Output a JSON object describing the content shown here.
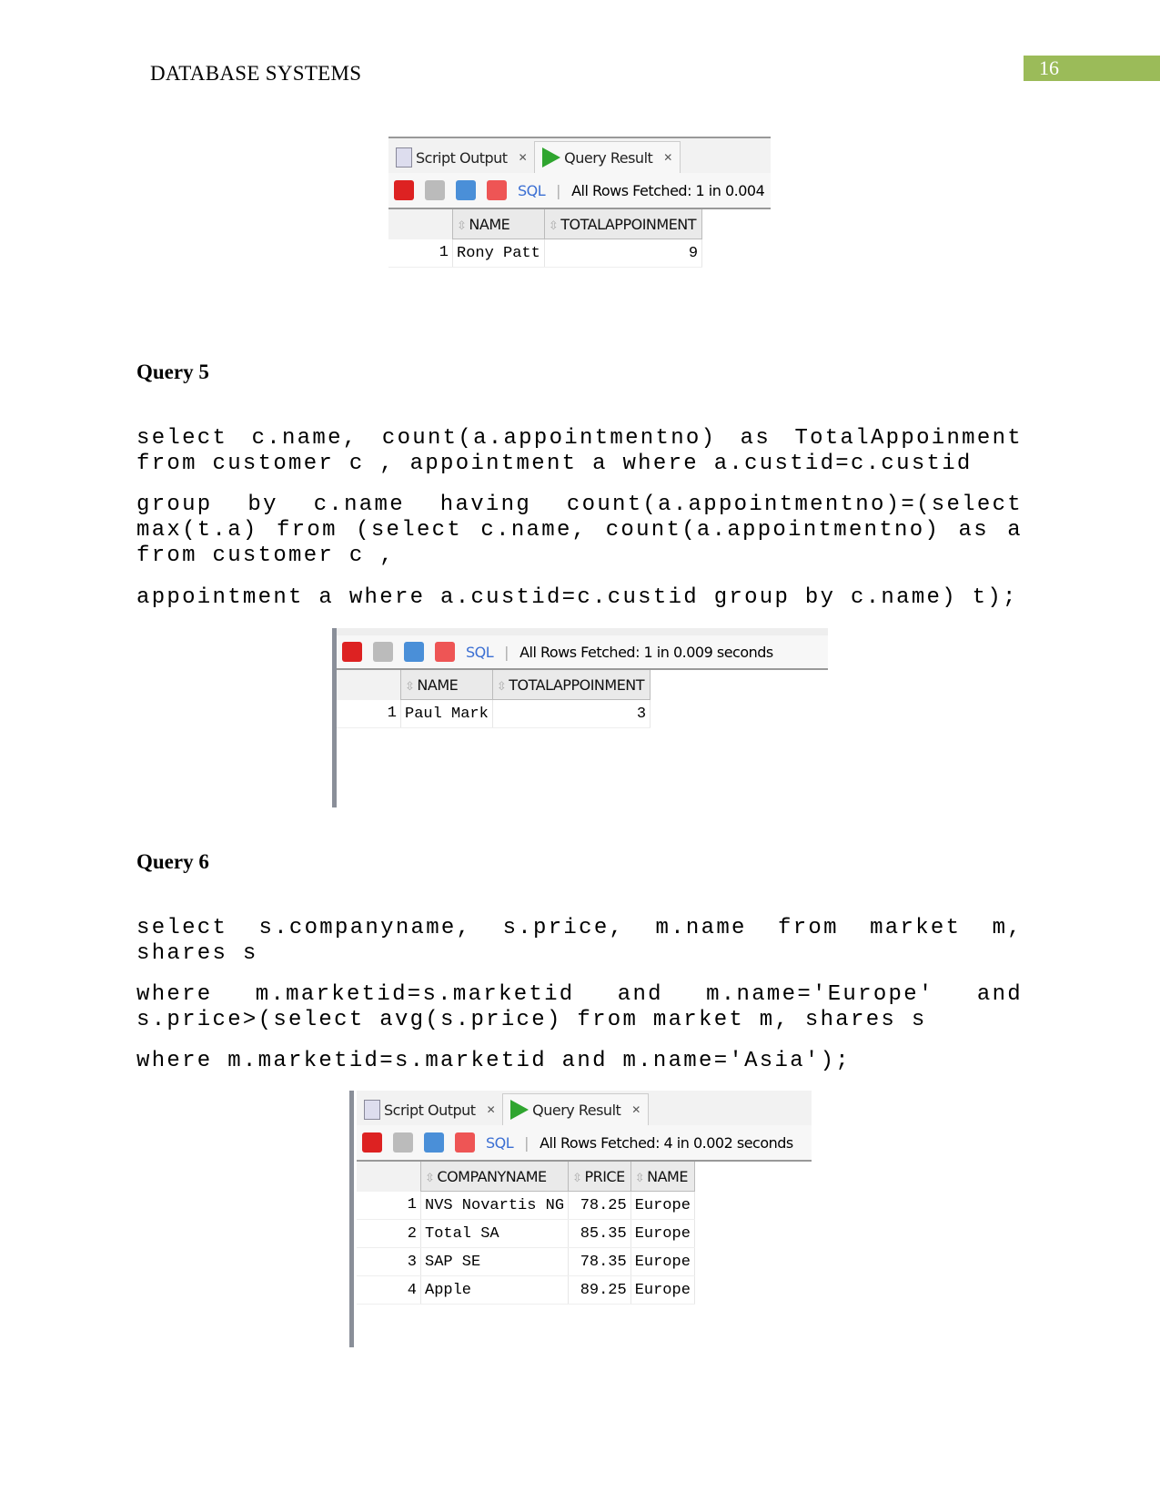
{
  "header": {
    "title": "DATABASE SYSTEMS",
    "page_number": "16"
  },
  "colors": {
    "page_number_bg": "#9bbb59",
    "play": "#2fa52f",
    "sql_link": "#3b6fd3"
  },
  "result1": {
    "tabs": [
      "Script Output",
      "Query Result"
    ],
    "sql": "SQL",
    "status": "All Rows Fetched: 1 in 0.004",
    "columns": [
      "NAME",
      "TOTALAPPOINMENT"
    ],
    "rows": [
      [
        "1",
        "Rony Patt",
        "9"
      ]
    ]
  },
  "query5": {
    "heading": "Query 5",
    "lines": [
      "select  c.name, count(a.appointmentno) as TotalAppoinment from customer c , appointment a where a.custid=c.custid",
      "group  by  c.name  having  count(a.appointmentno)=(select max(t.a) from (select c.name, count(a.appointmentno) as a from customer c ,",
      "appointment a where a.custid=c.custid group by c.name) t);"
    ]
  },
  "result2": {
    "sql": "SQL",
    "status": "All Rows Fetched: 1 in 0.009 seconds",
    "columns": [
      "NAME",
      "TOTALAPPOINMENT"
    ],
    "rows": [
      [
        "1",
        "Paul Mark",
        "3"
      ]
    ]
  },
  "query6": {
    "heading": "Query 6",
    "lines": [
      "select  s.companyname,  s.price,  m.name  from  market  m, shares s",
      "where  m.marketid=s.marketid  and  m.name='Europe'  and s.price>(select avg(s.price) from market m, shares s",
      "where m.marketid=s.marketid and m.name='Asia');"
    ]
  },
  "result3": {
    "tabs": [
      "Script Output",
      "Query Result"
    ],
    "sql": "SQL",
    "status": "All Rows Fetched: 4 in 0.002 seconds",
    "columns": [
      "COMPANYNAME",
      "PRICE",
      "NAME"
    ],
    "rows": [
      [
        "1",
        "NVS Novartis NG",
        "78.25",
        "Europe"
      ],
      [
        "2",
        "Total SA",
        "85.35",
        "Europe"
      ],
      [
        "3",
        "SAP SE",
        "78.35",
        "Europe"
      ],
      [
        "4",
        "Apple",
        "89.25",
        "Europe"
      ]
    ]
  }
}
